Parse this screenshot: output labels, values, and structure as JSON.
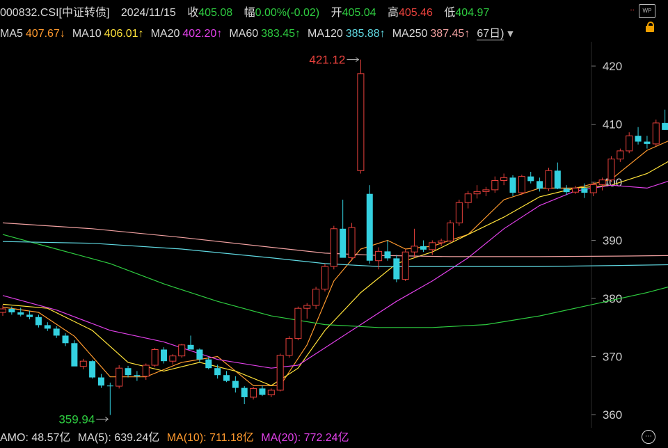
{
  "header": {
    "code": "000832.CSI[中证转债]",
    "date": "2024/11/15",
    "close_label": "收",
    "close_value": "405.08",
    "change_label": "幅",
    "change_value": "0.00%(-0.02)",
    "open_label": "开",
    "open_value": "405.04",
    "high_label": "高",
    "high_value": "405.46",
    "low_label": "低",
    "low_value": "404.97",
    "badge": "WP"
  },
  "ma_bar": {
    "items": [
      {
        "label": "MA5",
        "value": "407.67↓",
        "color": "#ff9a2e"
      },
      {
        "label": "MA10",
        "value": "406.01↑",
        "color": "#ffe23a"
      },
      {
        "label": "MA20",
        "value": "402.20↑",
        "color": "#e040e8"
      },
      {
        "label": "MA60",
        "value": "383.45↑",
        "color": "#2ecc40"
      },
      {
        "label": "MA120",
        "value": "385.88↑",
        "color": "#5fd7e0"
      },
      {
        "label": "MA250",
        "value": "387.45↑",
        "color": "#f0a0a0"
      }
    ],
    "period": "67日)"
  },
  "footer": {
    "amo_label": "AMO:",
    "amo_value": "48.57亿",
    "ma5_label": "MA(5):",
    "ma5_value": "639.24亿",
    "ma10_label": "MA(10):",
    "ma10_value": "711.18亿",
    "ma20_label": "MA(20):",
    "ma20_value": "772.24亿"
  },
  "colors": {
    "up": "#e8413c",
    "down": "#34d1e0",
    "text": "#d8d8d8",
    "grid": "#333333"
  },
  "chart_data": {
    "type": "candlestick",
    "ylim": [
      357,
      424
    ],
    "yticks": [
      360,
      370,
      380,
      390,
      400,
      410,
      420
    ],
    "annotations": [
      {
        "text": "421.12",
        "value": 421.12,
        "index": 40
      },
      {
        "text": "359.94",
        "value": 359.94,
        "index": 12
      }
    ],
    "candles": [
      [
        377.6,
        378.8,
        377.0,
        378.2
      ],
      [
        378.2,
        378.6,
        377.2,
        377.6
      ],
      [
        377.6,
        378.4,
        376.9,
        377.2
      ],
      [
        377.2,
        377.9,
        376.4,
        376.8
      ],
      [
        376.8,
        377.2,
        375.0,
        375.4
      ],
      [
        375.4,
        375.9,
        374.4,
        374.8
      ],
      [
        374.8,
        375.2,
        373.2,
        373.6
      ],
      [
        373.6,
        374.0,
        371.8,
        372.3
      ],
      [
        372.3,
        372.8,
        368.4,
        368.3
      ],
      [
        368.3,
        369.6,
        367.8,
        369.2
      ],
      [
        369.2,
        369.4,
        366.2,
        366.4
      ],
      [
        366.4,
        367.0,
        364.6,
        365.0
      ],
      [
        365.0,
        365.5,
        359.94,
        364.9
      ],
      [
        364.9,
        368.5,
        364.5,
        368.0
      ],
      [
        368.0,
        368.4,
        366.4,
        366.8
      ],
      [
        366.8,
        367.5,
        365.8,
        366.6
      ],
      [
        366.6,
        368.8,
        366.0,
        368.5
      ],
      [
        368.5,
        371.5,
        368.2,
        371.2
      ],
      [
        371.2,
        371.6,
        368.8,
        369.2
      ],
      [
        369.2,
        370.4,
        368.6,
        370.1
      ],
      [
        370.1,
        372.2,
        369.8,
        372.0
      ],
      [
        372.0,
        373.6,
        371.4,
        371.2
      ],
      [
        371.2,
        371.4,
        369.0,
        369.5
      ],
      [
        369.5,
        369.9,
        367.8,
        368.0
      ],
      [
        368.0,
        368.6,
        366.2,
        366.8
      ],
      [
        366.8,
        367.5,
        365.6,
        365.8
      ],
      [
        365.8,
        366.6,
        363.8,
        364.6
      ],
      [
        364.6,
        364.9,
        361.8,
        363.0
      ],
      [
        363.0,
        364.8,
        362.6,
        364.5
      ],
      [
        364.5,
        365.0,
        363.2,
        363.4
      ],
      [
        363.4,
        364.5,
        363.0,
        364.2
      ],
      [
        364.2,
        370.5,
        364.0,
        370.2
      ],
      [
        370.2,
        373.5,
        369.8,
        373.1
      ],
      [
        373.1,
        378.6,
        372.8,
        378.3
      ],
      [
        378.3,
        379.2,
        376.5,
        378.8
      ],
      [
        378.8,
        382.0,
        378.2,
        381.6
      ],
      [
        381.6,
        386.0,
        381.2,
        385.5
      ],
      [
        385.5,
        392.5,
        385.0,
        392.0
      ],
      [
        392.0,
        397.0,
        390.5,
        387.0
      ],
      [
        387.0,
        393.0,
        386.5,
        392.2
      ],
      [
        402.0,
        421.12,
        401.5,
        418.7
      ],
      [
        398.0,
        399.5,
        386.0,
        386.5
      ],
      [
        386.5,
        388.8,
        385.0,
        388.1
      ],
      [
        388.1,
        390.0,
        386.5,
        386.9
      ],
      [
        386.9,
        387.5,
        382.8,
        383.3
      ],
      [
        383.3,
        388.5,
        383.0,
        388.0
      ],
      [
        388.0,
        392.0,
        387.0,
        389.0
      ],
      [
        389.0,
        390.0,
        388.0,
        388.4
      ],
      [
        388.4,
        390.0,
        387.5,
        389.6
      ],
      [
        389.6,
        390.3,
        389.0,
        389.9
      ],
      [
        389.9,
        393.5,
        389.6,
        393.0
      ],
      [
        393.0,
        397.0,
        392.5,
        396.5
      ],
      [
        396.5,
        398.5,
        395.5,
        398.0
      ],
      [
        398.0,
        399.5,
        397.2,
        398.4
      ],
      [
        398.4,
        399.2,
        397.6,
        398.7
      ],
      [
        398.7,
        401.0,
        398.2,
        400.3
      ],
      [
        400.3,
        401.5,
        399.5,
        400.8
      ],
      [
        400.8,
        401.2,
        397.6,
        398.2
      ],
      [
        398.2,
        401.3,
        397.8,
        401.0
      ],
      [
        401.0,
        401.8,
        399.8,
        400.2
      ],
      [
        400.2,
        400.8,
        398.4,
        398.9
      ],
      [
        398.9,
        402.5,
        398.5,
        402.0
      ],
      [
        402.0,
        403.4,
        398.8,
        398.9
      ],
      [
        398.9,
        399.5,
        397.8,
        398.3
      ],
      [
        398.3,
        399.4,
        398.0,
        399.0
      ],
      [
        399.0,
        399.8,
        397.3,
        398.2
      ],
      [
        398.2,
        400.0,
        397.6,
        399.6
      ],
      [
        399.6,
        400.8,
        398.6,
        400.4
      ],
      [
        400.4,
        404.5,
        400.0,
        404.0
      ],
      [
        404.0,
        405.8,
        403.5,
        405.4
      ],
      [
        405.4,
        408.6,
        405.0,
        408.0
      ],
      [
        408.0,
        409.5,
        406.5,
        407.0
      ],
      [
        407.0,
        408.0,
        405.8,
        406.6
      ],
      [
        406.6,
        410.8,
        406.2,
        410.2
      ],
      [
        410.2,
        412.5,
        409.0,
        409.0
      ],
      [
        409.0,
        409.8,
        407.6,
        408.4
      ],
      [
        408.4,
        409.0,
        405.4,
        409.2
      ],
      [
        409.2,
        409.4,
        405.0,
        405.08
      ]
    ],
    "ma": [
      {
        "name": "MA5",
        "color": "#ff9a2e",
        "points": [
          [
            0,
            378.5
          ],
          [
            4,
            377.6
          ],
          [
            8,
            373.5
          ],
          [
            12,
            366.5
          ],
          [
            16,
            366.5
          ],
          [
            20,
            369.0
          ],
          [
            24,
            370.0
          ],
          [
            28,
            365.0
          ],
          [
            31,
            365.0
          ],
          [
            34,
            372.0
          ],
          [
            37,
            383.0
          ],
          [
            40,
            388.5
          ],
          [
            43,
            390.0
          ],
          [
            45,
            388.5
          ],
          [
            48,
            389.0
          ],
          [
            52,
            391.0
          ],
          [
            56,
            397.0
          ],
          [
            60,
            399.0
          ],
          [
            64,
            399.0
          ],
          [
            68,
            400.5
          ],
          [
            72,
            405.5
          ],
          [
            76,
            408.2
          ],
          [
            78,
            407.67
          ]
        ]
      },
      {
        "name": "MA10",
        "color": "#ffe23a",
        "points": [
          [
            0,
            379.0
          ],
          [
            5,
            378.3
          ],
          [
            10,
            374.5
          ],
          [
            14,
            369.0
          ],
          [
            18,
            367.5
          ],
          [
            22,
            369.0
          ],
          [
            26,
            367.5
          ],
          [
            30,
            365.0
          ],
          [
            33,
            368.0
          ],
          [
            36,
            374.5
          ],
          [
            40,
            381.0
          ],
          [
            44,
            386.0
          ],
          [
            48,
            388.0
          ],
          [
            52,
            391.0
          ],
          [
            56,
            394.0
          ],
          [
            60,
            397.5
          ],
          [
            64,
            399.0
          ],
          [
            68,
            399.5
          ],
          [
            72,
            401.5
          ],
          [
            76,
            405.0
          ],
          [
            78,
            406.01
          ]
        ]
      },
      {
        "name": "MA20",
        "color": "#e040e8",
        "points": [
          [
            0,
            380.5
          ],
          [
            6,
            378.0
          ],
          [
            12,
            374.5
          ],
          [
            18,
            372.5
          ],
          [
            24,
            369.5
          ],
          [
            30,
            368.0
          ],
          [
            33,
            368.5
          ],
          [
            36,
            371.5
          ],
          [
            40,
            375.5
          ],
          [
            44,
            379.5
          ],
          [
            48,
            383.0
          ],
          [
            52,
            387.0
          ],
          [
            56,
            392.0
          ],
          [
            60,
            396.0
          ],
          [
            64,
            398.5
          ],
          [
            68,
            399.5
          ],
          [
            72,
            399.0
          ],
          [
            76,
            401.0
          ],
          [
            78,
            402.2
          ]
        ]
      },
      {
        "name": "MA60",
        "color": "#2ecc40",
        "points": [
          [
            0,
            391.0
          ],
          [
            6,
            388.5
          ],
          [
            12,
            386.0
          ],
          [
            18,
            382.5
          ],
          [
            24,
            379.5
          ],
          [
            30,
            377.0
          ],
          [
            36,
            375.5
          ],
          [
            42,
            375.0
          ],
          [
            48,
            375.0
          ],
          [
            54,
            375.5
          ],
          [
            60,
            377.0
          ],
          [
            66,
            379.0
          ],
          [
            72,
            381.0
          ],
          [
            78,
            383.45
          ]
        ]
      },
      {
        "name": "MA120",
        "color": "#5fd7e0",
        "points": [
          [
            0,
            389.8
          ],
          [
            10,
            389.5
          ],
          [
            20,
            388.5
          ],
          [
            30,
            387.0
          ],
          [
            36,
            386.0
          ],
          [
            42,
            385.5
          ],
          [
            50,
            385.5
          ],
          [
            60,
            385.5
          ],
          [
            70,
            385.7
          ],
          [
            78,
            385.88
          ]
        ]
      },
      {
        "name": "MA250",
        "color": "#f0a0a0",
        "points": [
          [
            0,
            393.0
          ],
          [
            10,
            392.0
          ],
          [
            20,
            390.5
          ],
          [
            30,
            388.8
          ],
          [
            36,
            387.8
          ],
          [
            42,
            387.4
          ],
          [
            50,
            387.2
          ],
          [
            60,
            387.2
          ],
          [
            70,
            387.3
          ],
          [
            78,
            387.45
          ]
        ]
      }
    ]
  }
}
